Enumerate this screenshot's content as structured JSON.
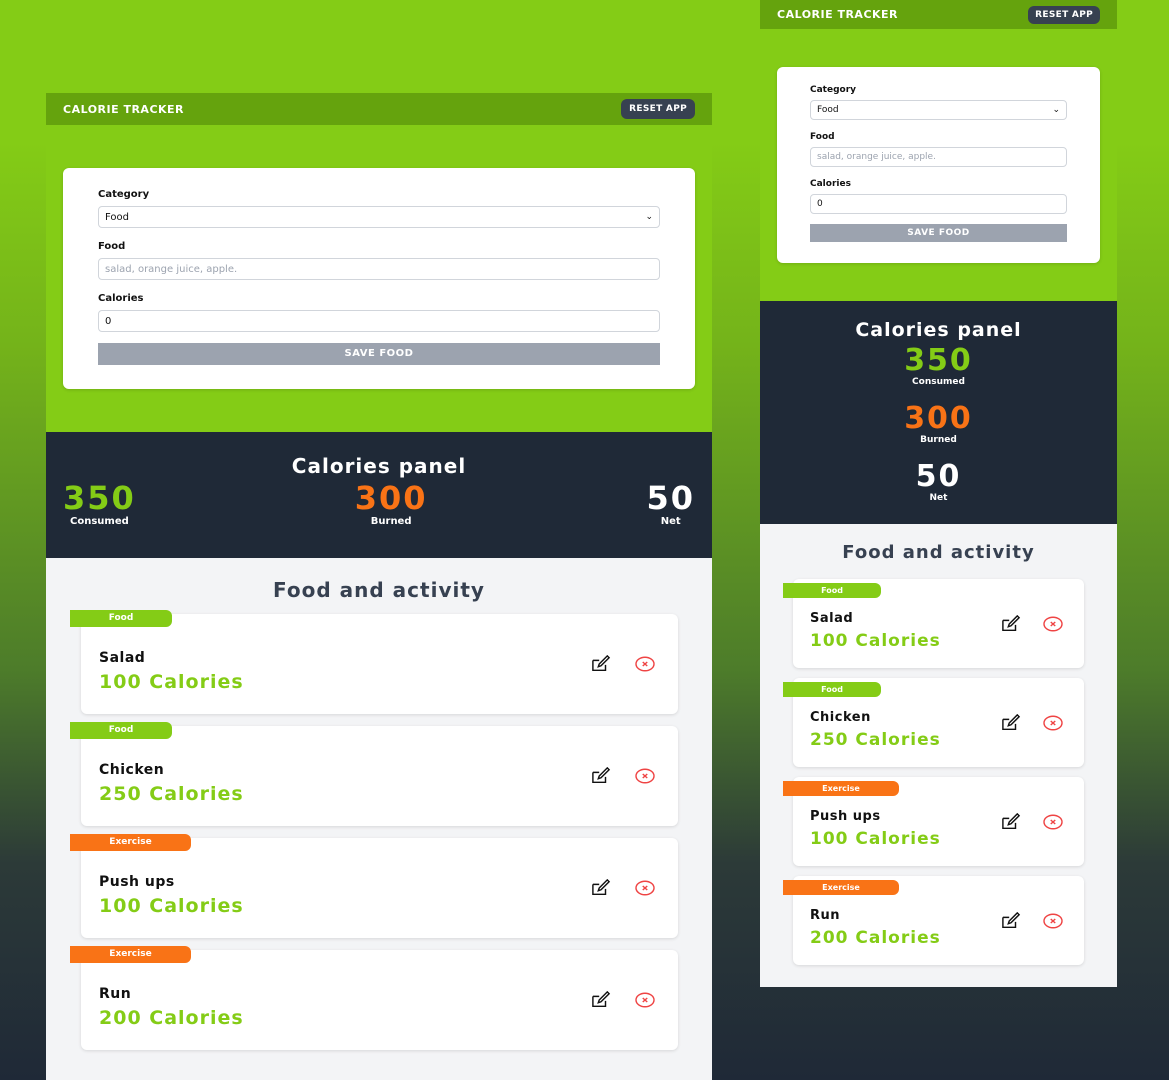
{
  "header": {
    "title": "CALORIE TRACKER",
    "reset_label": "RESET APP"
  },
  "form": {
    "category_label": "Category",
    "category_value": "Food",
    "food_label": "Food",
    "food_placeholder": "salad, orange juice, apple.",
    "calories_label": "Calories",
    "calories_value": "0",
    "save_label": "SAVE FOOD"
  },
  "panel": {
    "title": "Calories panel",
    "consumed_value": "350",
    "consumed_label": "Consumed",
    "burned_value": "300",
    "burned_label": "Burned",
    "net_value": "50",
    "net_label": "Net"
  },
  "activity": {
    "title": "Food and activity",
    "items": [
      {
        "category": "Food",
        "name": "Salad",
        "calories": "100 Calories"
      },
      {
        "category": "Food",
        "name": "Chicken",
        "calories": "250 Calories"
      },
      {
        "category": "Exercise",
        "name": "Push ups",
        "calories": "100 Calories"
      },
      {
        "category": "Exercise",
        "name": "Run",
        "calories": "200 Calories"
      }
    ]
  },
  "colors": {
    "accent": "#84cc16",
    "header": "#65a30d",
    "burned": "#f97316",
    "panel_bg": "#1f2937",
    "delete": "#ef4444"
  },
  "icons": {
    "edit": "pencil-square-icon",
    "delete": "x-circle-icon",
    "select": "chevron-down-icon"
  }
}
